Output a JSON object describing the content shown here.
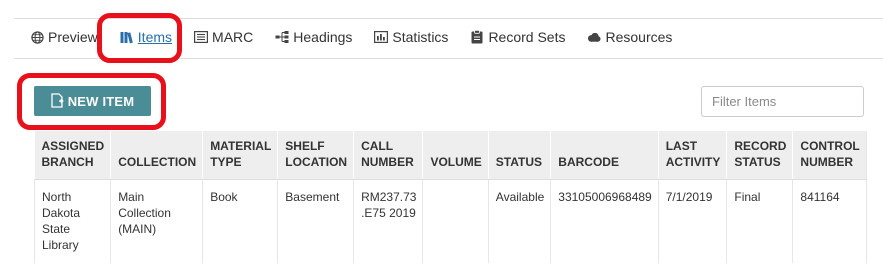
{
  "tabs": [
    {
      "label": "Preview",
      "icon": "globe-icon",
      "active": false
    },
    {
      "label": "Items",
      "icon": "books-icon",
      "active": true
    },
    {
      "label": "MARC",
      "icon": "list-box-icon",
      "active": false
    },
    {
      "label": "Headings",
      "icon": "tree-icon",
      "active": false
    },
    {
      "label": "Statistics",
      "icon": "bar-chart-icon",
      "active": false
    },
    {
      "label": "Record Sets",
      "icon": "clipboard-icon",
      "active": false
    },
    {
      "label": "Resources",
      "icon": "cloud-icon",
      "active": false
    }
  ],
  "new_item": {
    "label": "NEW ITEM",
    "icon": "add-file-icon"
  },
  "filter": {
    "placeholder": "Filter Items",
    "value": ""
  },
  "table": {
    "headers": [
      {
        "line1": "ASSIGNED",
        "line2": "BRANCH"
      },
      {
        "line1": "",
        "line2": "COLLECTION"
      },
      {
        "line1": "MATERIAL",
        "line2": "TYPE"
      },
      {
        "line1": "SHELF",
        "line2": "LOCATION"
      },
      {
        "line1": "CALL",
        "line2": "NUMBER"
      },
      {
        "line1": "",
        "line2": "VOLUME"
      },
      {
        "line1": "",
        "line2": "STATUS"
      },
      {
        "line1": "",
        "line2": "BARCODE"
      },
      {
        "line1": "LAST",
        "line2": "ACTIVITY"
      },
      {
        "line1": "RECORD",
        "line2": "STATUS"
      },
      {
        "line1": "CONTROL",
        "line2": "NUMBER"
      }
    ],
    "rows": [
      {
        "branch": [
          "North",
          "Dakota",
          "State",
          "Library"
        ],
        "collection": [
          "Main",
          "Collection",
          "(MAIN)"
        ],
        "material_type": "Book",
        "shelf_location": "Basement",
        "call_number": [
          "RM237.73",
          ".E75 2019"
        ],
        "volume": "",
        "status": "Available",
        "barcode": "33105006968489",
        "last_activity": "7/1/2019",
        "record_status": "Final",
        "control_number": "841164"
      }
    ]
  },
  "colors": {
    "accent": "#4a8d96",
    "active_tab": "#2a6fa8",
    "highlight": "#e8101a"
  }
}
